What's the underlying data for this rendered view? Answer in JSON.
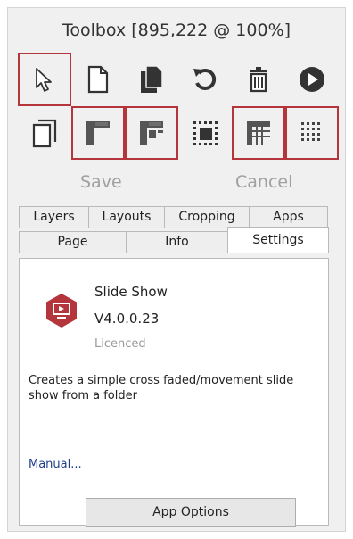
{
  "window": {
    "title": "Toolbox [895,222 @ 100%]"
  },
  "toolbar": {
    "row1": [
      {
        "icon": "pointer-icon",
        "selected": true
      },
      {
        "icon": "blank-page-icon",
        "selected": false
      },
      {
        "icon": "pages-icon",
        "selected": false
      },
      {
        "icon": "rotate-icon",
        "selected": false
      },
      {
        "icon": "trash-icon",
        "selected": false
      },
      {
        "icon": "play-icon",
        "selected": false
      }
    ],
    "row2": [
      {
        "icon": "copy-page-icon",
        "selected": false
      },
      {
        "icon": "layout-corner-icon",
        "selected": true
      },
      {
        "icon": "layout-split-icon",
        "selected": true
      },
      {
        "icon": "crop-center-icon",
        "selected": false
      },
      {
        "icon": "grid-lines-icon",
        "selected": true
      },
      {
        "icon": "dot-grid-icon",
        "selected": true
      }
    ],
    "save_label": "Save",
    "cancel_label": "Cancel"
  },
  "tabs": {
    "row1": [
      "Layers",
      "Layouts",
      "Cropping",
      "Apps"
    ],
    "row2": [
      "Page",
      "Info",
      "Settings"
    ],
    "active": "Settings"
  },
  "app": {
    "name": "Slide Show",
    "version": "V4.0.0.23",
    "license": "Licenced",
    "description": "Creates a simple cross faded/movement slide show from a folder",
    "manual_link": "Manual...",
    "options_button": "App Options",
    "icon": "slideshow-hexagon-icon"
  },
  "colors": {
    "accent": "#b5353d",
    "link": "#1f3d8a",
    "disabled_text": "#a0a0a0"
  }
}
